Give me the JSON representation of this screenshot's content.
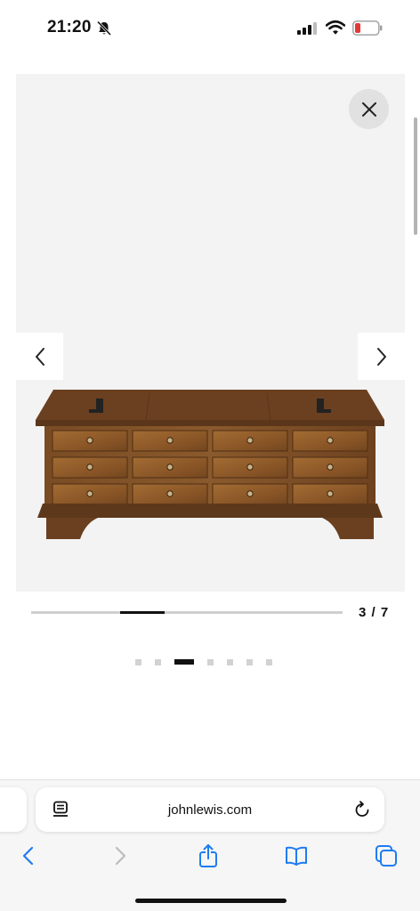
{
  "status_bar": {
    "time": "21:20",
    "icons": [
      "bell-slash-icon",
      "cellular-signal-icon",
      "wifi-icon",
      "battery-low-icon"
    ],
    "battery_color": "#e53935"
  },
  "gallery": {
    "image_subject": "dark wood coffee table chest with 12 drawers",
    "close_icon": "close-icon",
    "prev_icon": "chevron-left-icon",
    "next_icon": "chevron-right-icon",
    "current": 3,
    "total": 7,
    "counter_text": "3 / 7",
    "progress": 0.3,
    "dot_count": 7,
    "active_dot": 3
  },
  "browser": {
    "url": "johnlewis.com",
    "reader_icon": "page-format-icon",
    "reload_icon": "reload-icon",
    "toolbar": [
      "back-icon",
      "forward-icon",
      "share-icon",
      "bookmarks-icon",
      "tabs-icon"
    ],
    "accent": "#1e7cf2"
  }
}
